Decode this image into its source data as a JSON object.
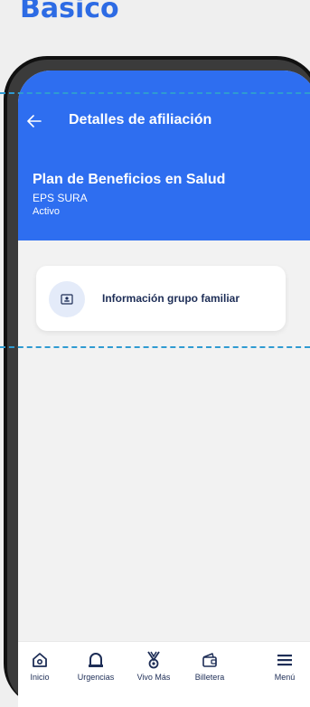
{
  "page": {
    "heading": "Basico"
  },
  "header": {
    "title": "Detalles de afiliación"
  },
  "plan": {
    "title": "Plan de Beneficios en Salud",
    "provider": "EPS SURA",
    "status": "Activo"
  },
  "card": {
    "label": "Información grupo familiar"
  },
  "nav": {
    "items": [
      {
        "label": "Inicio"
      },
      {
        "label": "Urgencias"
      },
      {
        "label": "Vivo Más"
      },
      {
        "label": "Billetera"
      },
      {
        "label": "Menú"
      }
    ]
  },
  "colors": {
    "primary": "#2e6ef0",
    "text_dark": "#1d2d56",
    "guide": "#2f9bd1"
  }
}
